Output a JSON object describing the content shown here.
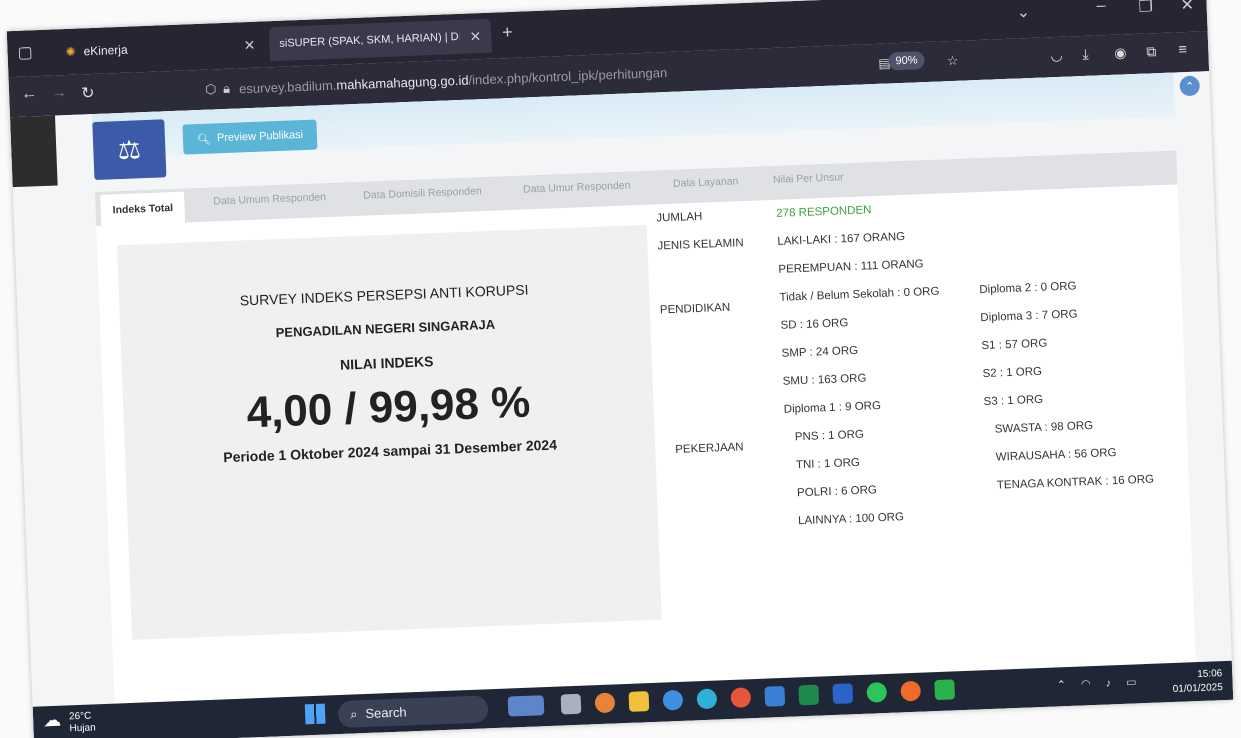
{
  "browser": {
    "tab1": "eKinerja",
    "tab2": "siSUPER (SPAK, SKM, HARIAN) | Dir",
    "url_prefix": "esurvey.badilum.",
    "url_host": "mahkamahagung.go.id",
    "url_path": "/index.php/kontrol_ipk/perhitungan",
    "zoom": "90%"
  },
  "page": {
    "preview_button": "Preview Publikasi",
    "tabs": [
      "Indeks Total",
      "Data Umum Responden",
      "Data Domisili Responden",
      "Data Umur Responden",
      "Data Layanan",
      "Nilai Per Unsur"
    ],
    "survey_title": "SURVEY INDEKS PERSEPSI ANTI KORUPSI",
    "court": "PENGADILAN NEGERI SINGARAJA",
    "index_label": "NILAI INDEKS",
    "index_value": "4,00 / 99,98 %",
    "period": "Periode 1 Oktober 2024 sampai 31 Desember 2024"
  },
  "stats": {
    "jumlah_label": "JUMLAH",
    "jumlah_value": "278 RESPONDEN",
    "gender_label": "JENIS KELAMIN",
    "male": "LAKI-LAKI : 167 ORANG",
    "female": "PEREMPUAN : 111 ORANG",
    "education_label": "PENDIDIKAN",
    "edu_col1": [
      "Tidak / Belum Sekolah : 0 ORG",
      "SD : 16 ORG",
      "SMP : 24 ORG",
      "SMU : 163 ORG",
      "Diploma 1 : 9 ORG"
    ],
    "edu_col2": [
      "Diploma 2 : 0 ORG",
      "Diploma 3 : 7 ORG",
      "S1 : 57 ORG",
      "S2 : 1 ORG",
      "S3 : 1 ORG"
    ],
    "job_label": "PEKERJAAN",
    "job_col1": [
      "PNS : 1 ORG",
      "TNI : 1 ORG",
      "POLRI : 6 ORG",
      "LAINNYA : 100 ORG"
    ],
    "job_col2": [
      "SWASTA : 98 ORG",
      "WIRAUSAHA : 56 ORG",
      "TENAGA KONTRAK : 16 ORG"
    ]
  },
  "taskbar": {
    "temp": "26°C",
    "weather": "Hujan",
    "search": "Search",
    "time": "15:06",
    "date": "01/01/2025"
  }
}
